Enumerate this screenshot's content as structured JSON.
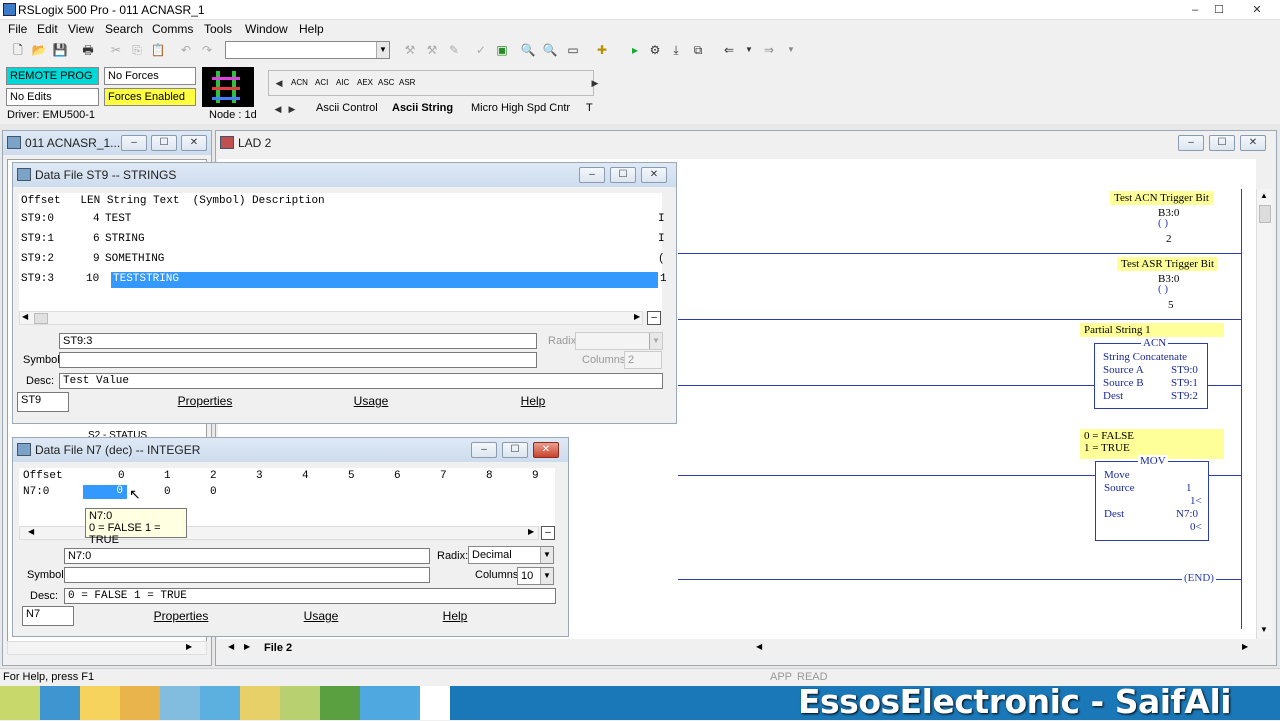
{
  "app": {
    "title": "RSLogix 500 Pro - 011 ACNASR_1",
    "minimize": "–",
    "maximize": "☐",
    "close": "✕"
  },
  "menu": [
    "File",
    "Edit",
    "View",
    "Search",
    "Comms",
    "Tools",
    "Window",
    "Help"
  ],
  "status_panel": {
    "mode": "REMOTE PROG",
    "forces": "No Forces",
    "edits": "No Edits",
    "forces_enabled": "Forces Enabled",
    "driver": "Driver: EMU500-1",
    "node": "Node : 1d"
  },
  "instr_palette": {
    "buttons": [
      "ACN",
      "ACI",
      "AIC",
      "AEX",
      "ASC",
      "ASR"
    ],
    "tabs": [
      "Ascii Control",
      "Ascii String",
      "Micro High Spd Cntr",
      "T"
    ]
  },
  "project_window": {
    "title": "011 ACNASR_1....",
    "item": "S2 - STATUS"
  },
  "lad_window": {
    "title": "LAD 2",
    "tab": "File 2",
    "rungs": [
      {
        "label": "Test ACN Trigger Bit",
        "addr": "B3:0",
        "bit": "2"
      },
      {
        "label": "Test ASR Trigger Bit",
        "addr": "B3:0",
        "bit": "5"
      }
    ],
    "acn": {
      "label": "Partial String 1",
      "mnemonic": "ACN",
      "name": "String Concatenate",
      "rows": [
        [
          "Source A",
          "ST9:0"
        ],
        [
          "Source B",
          "ST9:1"
        ],
        [
          "Dest",
          "ST9:2"
        ]
      ]
    },
    "mov": {
      "label1": "0 = FALSE",
      "label2": "1 = TRUE",
      "mnemonic": "MOV",
      "name": "Move",
      "source_label": "Source",
      "source_val": "1",
      "source_live": "1<",
      "dest_label": "Dest",
      "dest_val": "N7:0",
      "dest_live": "0<"
    },
    "end": "END"
  },
  "st9": {
    "title": "Data File ST9  --  STRINGS",
    "header": "Offset   LEN String Text  (Symbol) Description",
    "rows": [
      {
        "offset": "ST9:0",
        "len": "4",
        "text": "TEST",
        "end": "I"
      },
      {
        "offset": "ST9:1",
        "len": "6",
        "text": "STRING",
        "end": "I"
      },
      {
        "offset": "ST9:2",
        "len": "9",
        "text": "SOMETHING",
        "end": "("
      },
      {
        "offset": "ST9:3",
        "len": "10",
        "text": "TESTSTRING",
        "end": "1"
      }
    ],
    "address": "ST9:3",
    "symbol_label": "Symbol:",
    "symbol": "",
    "desc_label": "Desc:",
    "desc": "Test Value",
    "radix_label": "Radix:",
    "columns_label": "Columns:",
    "columns": "2",
    "file": "ST9",
    "properties": "Properties",
    "usage": "Usage",
    "help": "Help"
  },
  "n7": {
    "title": "Data File N7 (dec)  --  INTEGER",
    "offset_header": "Offset",
    "cols": [
      "0",
      "1",
      "2",
      "3",
      "4",
      "5",
      "6",
      "7",
      "8",
      "9"
    ],
    "row_label": "N7:0",
    "values": [
      "0",
      "0",
      "0"
    ],
    "tooltip1": "N7:0",
    "tooltip2": "0 = FALSE 1 = TRUE",
    "address": "N7:0",
    "radix_label": "Radix:",
    "radix": "Decimal",
    "symbol_label": "Symbol:",
    "symbol": "",
    "columns_label": "Columns:",
    "columns": "10",
    "desc_label": "Desc:",
    "desc": "0 = FALSE 1 = TRUE",
    "file": "N7",
    "properties": "Properties",
    "usage": "Usage",
    "help": "Help"
  },
  "statusbar": {
    "help": "For Help, press F1",
    "app": "APP",
    "read": "READ"
  },
  "watermark": "EssosElectronic - SaifAli"
}
